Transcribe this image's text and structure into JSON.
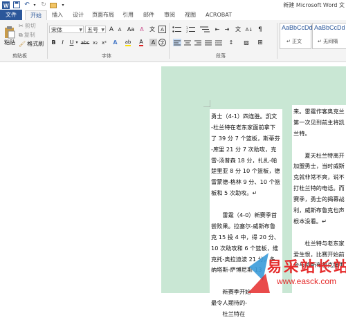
{
  "window": {
    "title": "新建 Microsoft Word 文"
  },
  "tabs": [
    {
      "label": "文件"
    },
    {
      "label": "开始"
    },
    {
      "label": "插入"
    },
    {
      "label": "设计"
    },
    {
      "label": "页面布局"
    },
    {
      "label": "引用"
    },
    {
      "label": "邮件"
    },
    {
      "label": "审阅"
    },
    {
      "label": "视图"
    },
    {
      "label": "ACROBAT"
    }
  ],
  "clipboard": {
    "paste": "粘贴",
    "cut": "剪切",
    "copy": "复制",
    "format_painter": "格式刷",
    "group": "剪贴板"
  },
  "font": {
    "name": "宋体",
    "size": "五号",
    "group": "字体",
    "grow": "A",
    "shrink": "A",
    "case": "Aa",
    "clear": "A",
    "phonetic": "文",
    "border": "A",
    "bold": "B",
    "italic": "I",
    "underline": "U",
    "strike": "abc",
    "sub": "x₂",
    "sup": "x²",
    "effects": "A",
    "highlight": "ab",
    "color": "A",
    "shade": "A",
    "circle": "字"
  },
  "paragraph": {
    "group": "段落"
  },
  "styles": [
    {
      "sample": "AaBbCcDd",
      "name": "↵ 正文"
    },
    {
      "sample": "AaBbCcDd",
      "name": "↵ 无间隔"
    }
  ],
  "doc": {
    "col1": [
      "勇士（4-1）四连胜。凯文",
      "-杜兰特在老东家面前拿下",
      "了 39 分 7 个篮板，斯蒂芬",
      "-库里 21 分 7 次助攻，克",
      "雷-汤普森 18 分，扎扎-帕",
      "楚里亚 8 分 10 个篮板，德",
      "雷蒙德-格林 9 分、10 个篮",
      "板和 5 次助攻。↵",
      "",
      "　　雷霆（4-0）新赛季首",
      "尝败果。拉塞尔-威斯布鲁",
      "克 15 投 4 中，得 20 分、",
      "10 次助攻和 6 个篮板，维",
      "克托-奥拉迪波 21 分，多",
      "纳塔斯-萨博尼斯 13",
      "",
      "　　新赛季开始",
      "最令人期待的-",
      "　　杜兰特在"
    ],
    "col2": [
      "来。雷霆作客奥克兰",
      "第一次见到前主将凯",
      "兰特。",
      "",
      "　　夏天杜兰特离开",
      "加盟勇士，当时威斯",
      "克就非常不爽，说不",
      "打杜兰特的电话。而",
      "赛季，勇士的揭幕战",
      "利，威斯布鲁克也声",
      "根本没看。↵",
      "",
      "　　杜兰特与老东家",
      "爱生恨，比赛开始前",
      "会与威斯布鲁克握手"
    ]
  },
  "watermark": {
    "main": "易采站长站",
    "url": "www.easck.com"
  }
}
